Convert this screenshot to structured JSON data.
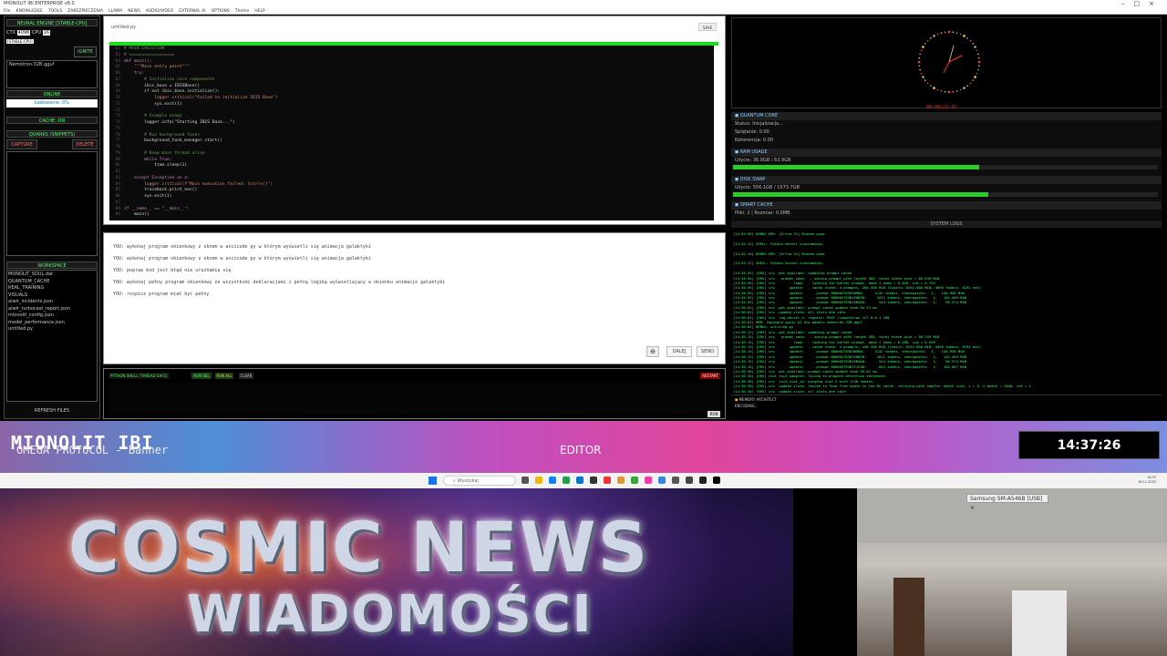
{
  "window": {
    "title": "MIONOLIT IBI ENTERPRISE v8.0"
  },
  "menu": [
    "File",
    "KNOWLEDGE",
    "TOOLS",
    "ZABEZPIECZENIA",
    "LLAMA",
    "NEWS",
    "AUDIO/VIDEO",
    "EXTERNAL AI",
    "OPTIONS",
    "Theme",
    "HELP"
  ],
  "sidebar": {
    "engine_title": "NEURAL ENGINE [STABLE-CPU]",
    "ctx_label": "CTX",
    "ctx_value": "4096",
    "cpu_label": "CPU",
    "cpu_value": "16",
    "stable_badge": "[STABLE-CPU]",
    "ignite": "IGNITE",
    "model": "Nemotron-32B.gguf",
    "status_online": "ONLINE",
    "loading": "Ładowanie: 0%",
    "cache": "CACHE: ON",
    "quarks_title": "QUARKS (SNIPPETS)",
    "capture": "CAPTURE",
    "delete": "DELETE",
    "workspace_title": "WORKSPACE",
    "files": [
      "MONOLIT_SOUL.dat",
      "QUANTUM_CACHE",
      "REAL_TRAINING",
      "VISUALS",
      "aiwir_incidents.json",
      "aiwir_turbocast_report.json",
      "mionolit_config.json",
      "model_performance.json",
      "untitled.py"
    ],
    "refresh": "REFRESH FILES"
  },
  "editor": {
    "tab": "untitled.py",
    "save": "SAVE",
    "code": [
      {
        "n": "62",
        "t": "# MAIN EXECUTION",
        "c": "#6a9955"
      },
      {
        "n": "63",
        "t": "# ==================",
        "c": "#6a9955"
      },
      {
        "n": "64",
        "t": "def main():",
        "c": "#c586c0"
      },
      {
        "n": "65",
        "t": "    \"\"\"Main entry point\"\"\"",
        "c": "#ce9178"
      },
      {
        "n": "66",
        "t": "    try:",
        "c": "#c586c0"
      },
      {
        "n": "67",
        "t": "        # Initialize core components",
        "c": "#6a9955"
      },
      {
        "n": "68",
        "t": "        ibis_base = IBISBase()",
        "c": "#dcdcdc"
      },
      {
        "n": "69",
        "t": "        if not ibis_base.initialize():",
        "c": "#dcdcdc"
      },
      {
        "n": "70",
        "t": "            logger.critical(\"Failed to initialize IBIS Base\")",
        "c": "#ce9178"
      },
      {
        "n": "71",
        "t": "            sys.exit(1)",
        "c": "#dcdcdc"
      },
      {
        "n": "72",
        "t": "",
        "c": "#dcdcdc"
      },
      {
        "n": "73",
        "t": "        # Example usage",
        "c": "#6a9955"
      },
      {
        "n": "74",
        "t": "        logger.info(\"Starting IBIS Base...\")",
        "c": "#dcdcdc"
      },
      {
        "n": "75",
        "t": "",
        "c": "#dcdcdc"
      },
      {
        "n": "76",
        "t": "        # Run background tasks",
        "c": "#6a9955"
      },
      {
        "n": "77",
        "t": "        background_task_manager.start()",
        "c": "#dcdcdc"
      },
      {
        "n": "78",
        "t": "",
        "c": "#dcdcdc"
      },
      {
        "n": "79",
        "t": "        # Keep main thread alive",
        "c": "#6a9955"
      },
      {
        "n": "80",
        "t": "        while True:",
        "c": "#c586c0"
      },
      {
        "n": "81",
        "t": "            time.sleep(1)",
        "c": "#dcdcdc"
      },
      {
        "n": "82",
        "t": "",
        "c": "#dcdcdc"
      },
      {
        "n": "83",
        "t": "    except Exception as e:",
        "c": "#c586c0"
      },
      {
        "n": "84",
        "t": "        logger.critical(f\"Main execution failed: {str(e)}\")",
        "c": "#ce9178"
      },
      {
        "n": "85",
        "t": "        traceback.print_exc()",
        "c": "#dcdcdc"
      },
      {
        "n": "86",
        "t": "        sys.exit(1)",
        "c": "#dcdcdc"
      },
      {
        "n": "87",
        "t": "",
        "c": "#dcdcdc"
      },
      {
        "n": "88",
        "t": "if __name__ == \"__main__\":",
        "c": "#c586c0"
      },
      {
        "n": "89",
        "t": "    main()",
        "c": "#dcdcdc"
      }
    ]
  },
  "chat": {
    "messages": [
      "YOU: wykonaj program okienkowy z oknem w ascicode py w którym wyświetli się animacja galaktyki",
      "YOU: wykonaj program okienkowy z oknem w ascicode py w którym wyświetli się animacja galaktyki",
      "YOU: popraw kod jest błąd nie uruchamia się",
      "YOU: wykonaj pełny program okienkowy ze wszystkimi deklaracjami i pełną logiką wyświetlający w okienku animacje galaktyki",
      "YOU: rozpisz program miał być pełny"
    ],
    "btn_stop": "⊖",
    "btn_dalej": "DALEJ",
    "btn_send": "SEND"
  },
  "shell": {
    "title": "PYTHON SHELL [THREAD SAFE]",
    "run_sel": "RUN SEL",
    "run_all": "RUN ALL",
    "clear": "CLEAR",
    "restart": "RESTART",
    "run": "RUN"
  },
  "right": {
    "clock_digital": "00:00:22:32",
    "quantum_title": "QUANTUM CORE",
    "quantum_status": "Status: Inicjalizacja...",
    "quantum_splatanie": "Splątanie: 0.00",
    "quantum_koherencja": "Koherencja: 0.00",
    "ram_title": "RAM USAGE",
    "ram_value": "Użycie: 36.9GB / 63.9GB",
    "ram_fraction": 0.58,
    "disk_title": "DISK SWAP",
    "disk_value": "Użycie: 556.1GB / 1573.7GB",
    "disk_fraction": 0.6,
    "cache_title": "SMART CACHE",
    "cache_value": "Pliki: 2 | Rozmiar: 0.0MB",
    "logs_title": "SYSTEM LOGS",
    "logs": [
      "[14:32:09] DEBUG ERR: [Errno 32] Broken pipe",
      "",
      "[14:32:12] SHELL: Python kernel uruchomiony.",
      "",
      "[14:32:14] DEBUG ERR: [Errno 32] Broken pipe",
      "",
      "[14:32:17] SHELL: Python kernel uruchomiony.",
      "",
      "[14:34:55] [SRV] srv  get_availabl: updating prompt cache",
      "[14:34:55] [SRV] srv   prompt_save:  - saving prompt with length 583, total state size = 66.633 MiB",
      "[14:34:55] [SRV] srv         load:  - looking for better prompt, base f_keep = 0.426, sim = 0.724",
      "[14:34:55] [SRV] srv       update:  - cache state: 4 prompts, 266.558 MiB (limits: 8192.000 MiB, 4096 tokens, 8192 est)",
      "[14:34:55] [SRV] srv       update:    - prompt 0000027E3D3B9B0:     1142 tokens, checkpoints:  1,   145.958 MiB",
      "[14:34:55] [SRV] srv       update:    - prompt 0000027E3D1E0DF0:     1011 tokens, checkpoints:  1,   144.469 MiB",
      "[14:34:55] [SRV] srv       update:    - prompt 0000027E3D1EB4A0:      544 tokens, checkpoints:  1,    96.574 MiB",
      "[14:36:01] [SRV] srv  get_availabl: prompt cache update took 84.53 ms",
      "[14:36:01] [SRV] srv  update_slots: all slots are idle",
      "[14:36:01] [SRV] srv  log_server_r: request: POST /completion 127.0.0.1 200",
      "[14:36:01] MEM: Zapisano wynik AI dla modelu nemotron-32B.gguf",
      "[14:36:02] DEBUG: untitled.py",
      "[14:36:15] [SRV] srv  get_availabl: updating prompt cache",
      "[14:36:15] [SRV] srv   prompt_save:  - saving prompt with length 583, total state size = 66.259 MiB",
      "[14:36:15] [SRV] srv         load:  - looking for better prompt, base f_keep = 0.288, sim = 0.659",
      "[14:36:15] [SRV] srv       update:  - cache state: 4 prompts, 446.558 MiB (limits: 8192.000 MiB, 4096 tokens, 8192 est)",
      "[14:36:15] [SRV] srv       update:    - prompt 0000027E3D3B9B0:     1142 tokens, checkpoints:  1,   145.958 MiB",
      "[14:36:15] [SRV] srv       update:    - prompt 0000027E3D1E0DF0:     1011 tokens, checkpoints:  1,   144.469 MiB",
      "[14:36:15] [SRV] srv       update:    - prompt 0000027E3D1EB4A0:      544 tokens, checkpoints:  1,    96.574 MiB",
      "[14:36:15] [SRV] srv       update:    - prompt 0000027E3D1C1FA0:      663 tokens, checkpoints:  1,   102.007 MiB",
      "[14:36:30] [SRV] srv  get_availabl: prompt cache update took 29.02 ms",
      "[14:36:30] [SRV] slot init_sampler: failed to prepare attention sentences",
      "[14:36:30] [SRV] srv  init_slot_id: purging slot 2 with 1136 tokens",
      "[14:36:30] [SRV] srv  update_slots: failed to find free space in the KV cache, retrying with smaller batch size, i = 0, n_batch = 2048, ret = 1",
      "[14:36:30] [SRV] srv  update_slots: all slots are idle",
      "[14:36:30] [SRV] srv  log_server_r: request: POST /completion 127.0.0.1 200",
      "[14:36:41] MEM: Zapisano wynik AI dla modelu nemotron-32B.gguf"
    ],
    "memory_title": "MEMORY ARCHITECT",
    "memory_status": "ENCODING..."
  },
  "banner": {
    "title": "MIONOLIT IBI",
    "subtitle": "OMEGA PROTOCOL - Banner",
    "mode": "EDITOR",
    "clock": "14:37:26"
  },
  "taskbar": {
    "search": "Wyszukaj",
    "time": "14:37",
    "date": "18.11.2025"
  },
  "news": {
    "line1": "COSMIC NEWS",
    "line2": "WIADOMOŚCI"
  },
  "camera": {
    "device_label": "Samsung SM-A546B [USB]"
  }
}
